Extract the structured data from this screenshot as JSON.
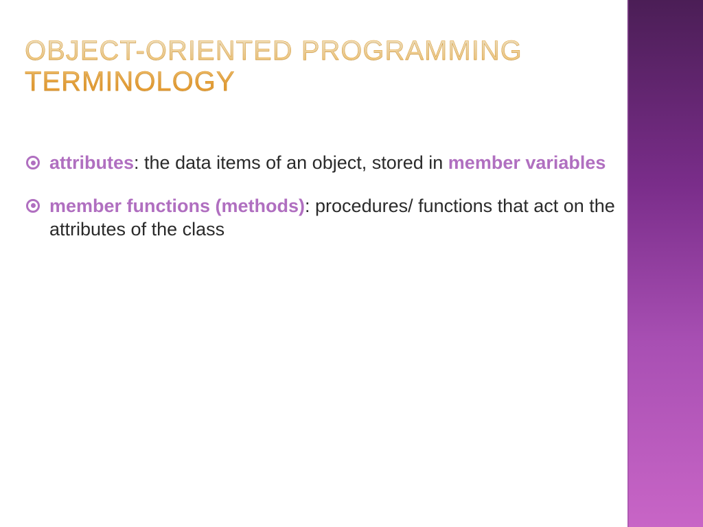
{
  "title_line1": "OBJECT-ORIENTED PROGRAMMING",
  "title_line2": "TERMINOLOGY",
  "bullets": [
    {
      "term": "attributes",
      "def1": ": the data items of an object, stored in ",
      "inline_term": "member variables",
      "def2": ""
    },
    {
      "term": "member functions (methods)",
      "def1": ": procedures/ functions that act on the attributes of the class",
      "inline_term": "",
      "def2": ""
    }
  ],
  "colors": {
    "accent_purple": "#b06fc0",
    "title_gradient_top": "#fff3d6",
    "title_gradient_bottom": "#f4a93c",
    "side_gradient_top": "#4b1e56",
    "side_gradient_bottom": "#c865c6"
  }
}
